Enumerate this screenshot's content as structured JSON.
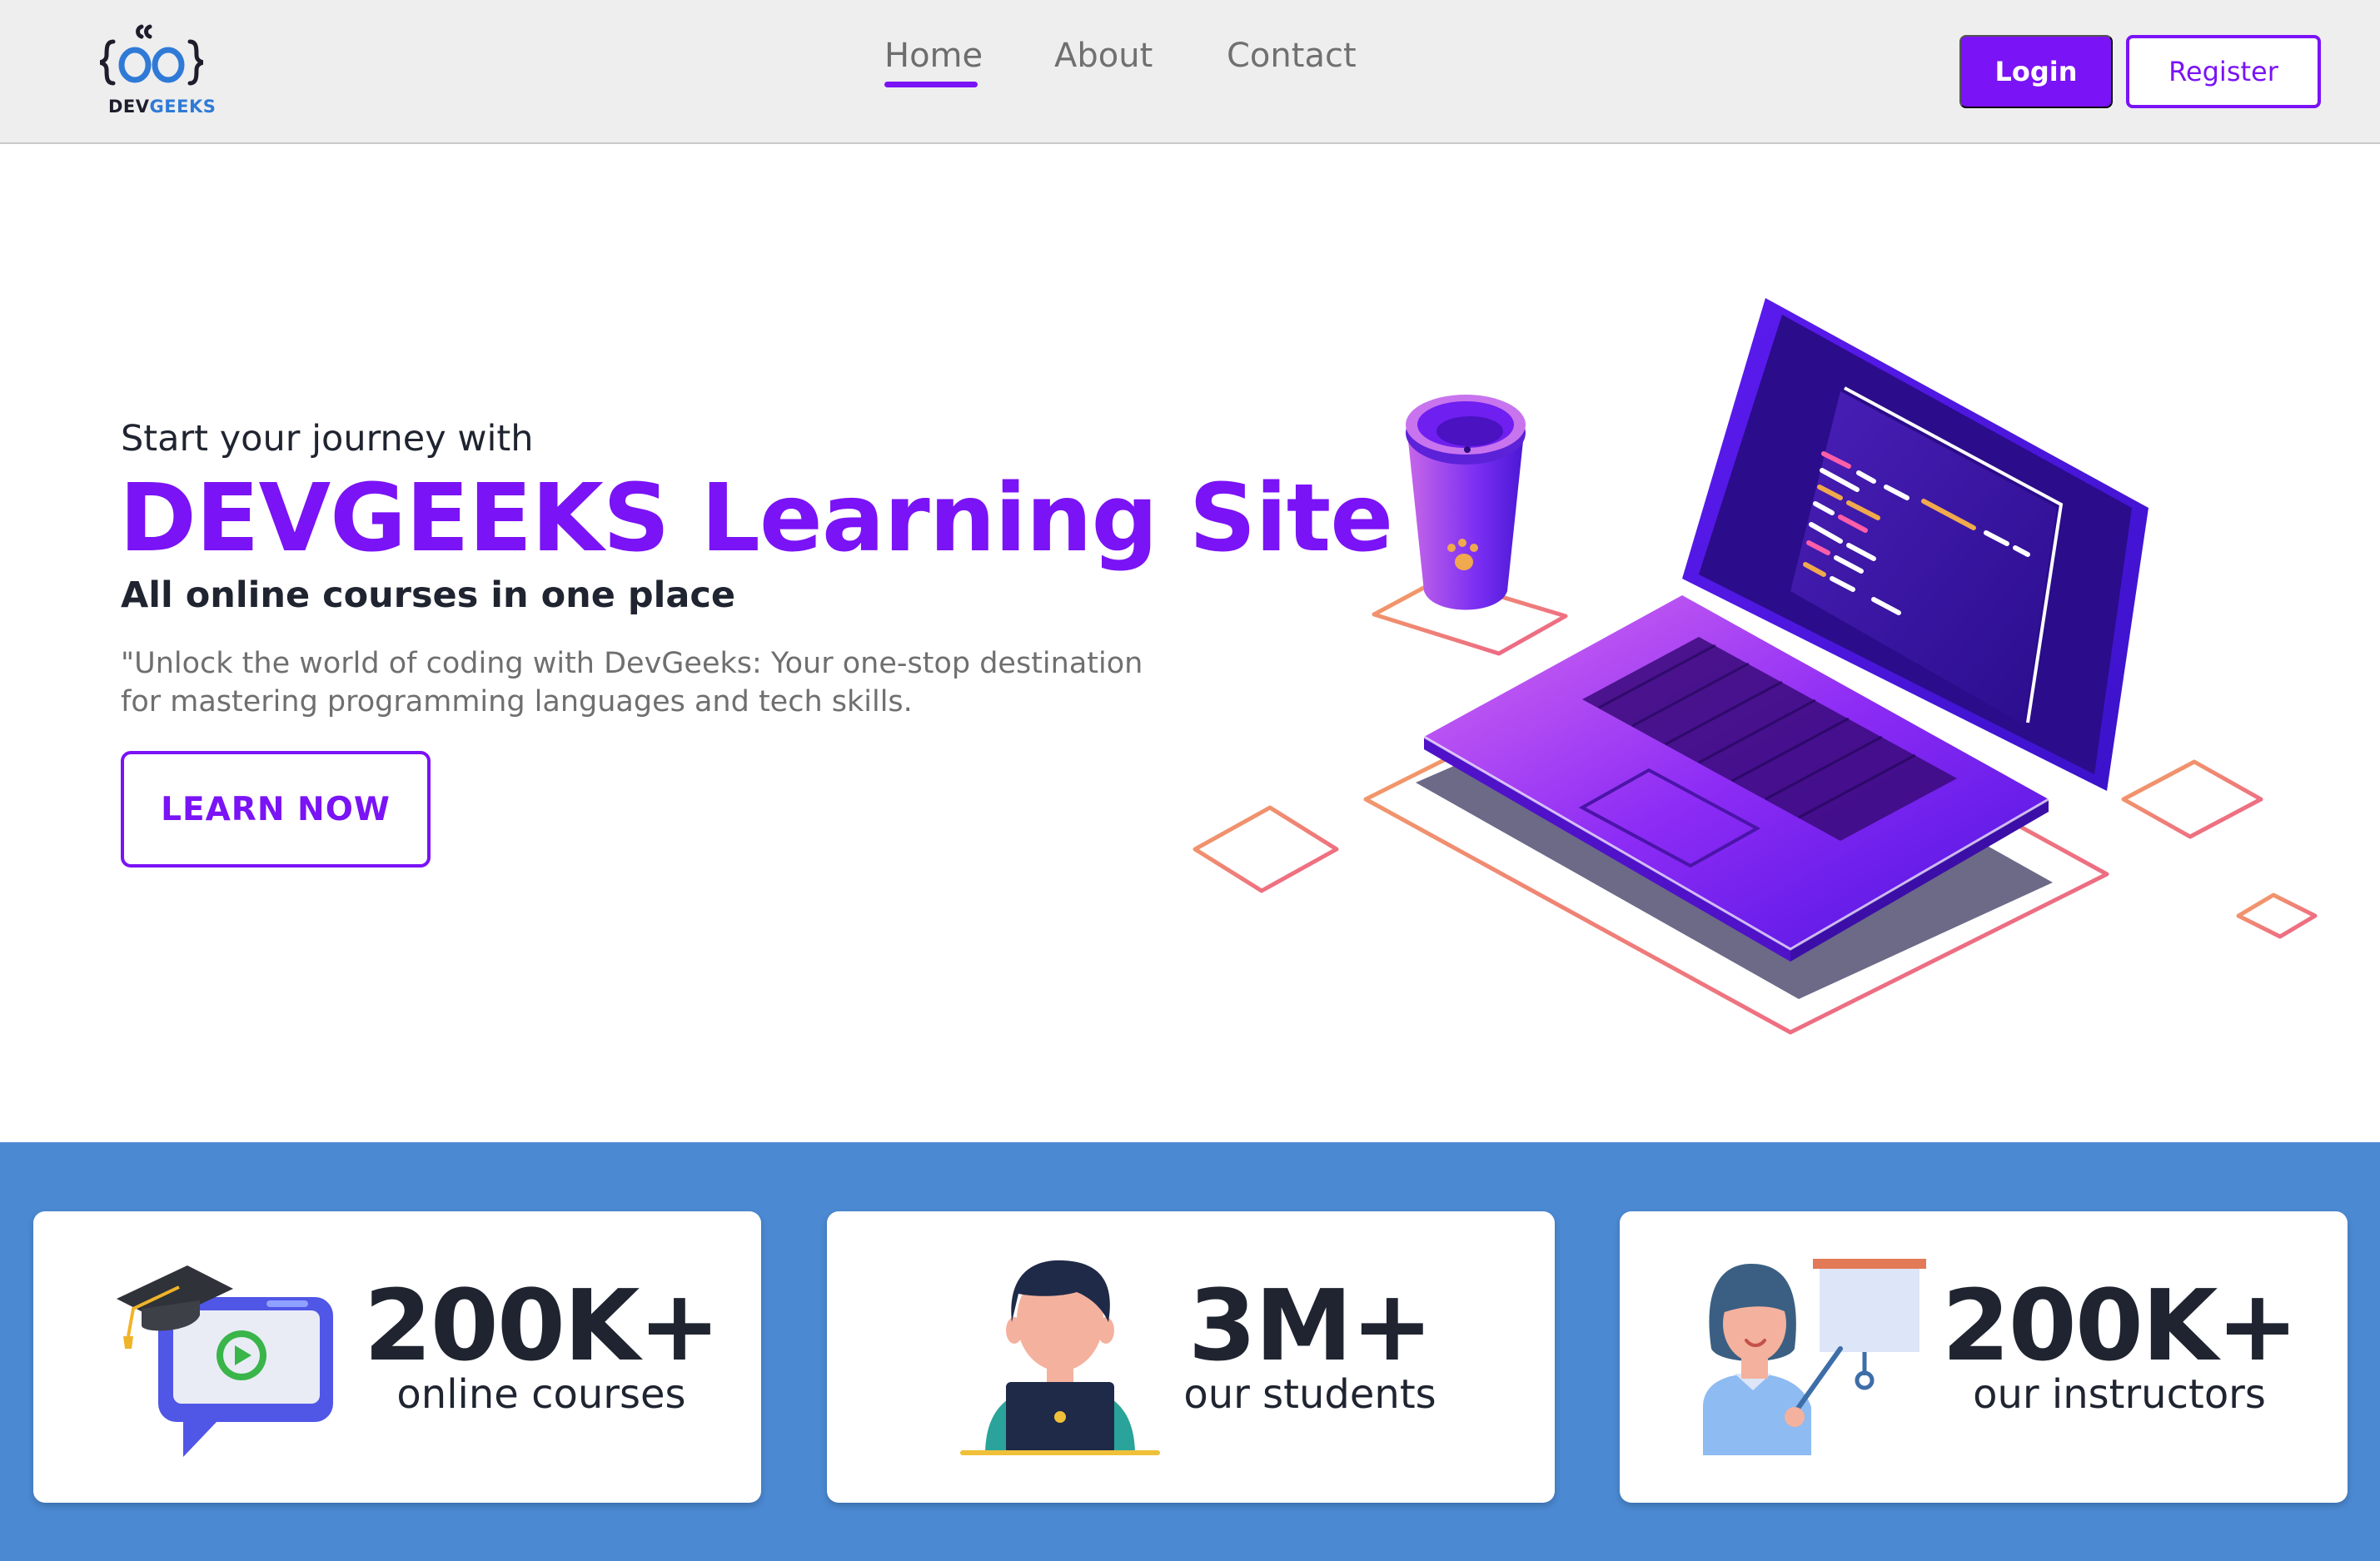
{
  "brand": {
    "name_part1": "DEV",
    "name_part2": "GEEKS",
    "icon": "devgeeks-logo-icon",
    "accent_color": "#7a13f5",
    "secondary_color": "#4b89d2"
  },
  "nav": {
    "links": [
      {
        "label": "Home",
        "active": true
      },
      {
        "label": "About",
        "active": false
      },
      {
        "label": "Contact",
        "active": false
      }
    ],
    "login_label": "Login",
    "register_label": "Register"
  },
  "hero": {
    "kicker": "Start your journey with",
    "title": "DEVGEEKS Learning Site",
    "subtitle": "All online courses in one place",
    "description": "\"Unlock the world of coding with DevGeeks: Your one-stop destination for mastering programming languages and tech skills.",
    "cta_label": "LEARN NOW",
    "illustration": "laptop-coffee-isometric-illustration"
  },
  "stats": [
    {
      "value": "200K+",
      "label": "online courses",
      "icon": "graduation-video-icon"
    },
    {
      "value": "3M+",
      "label": "our students",
      "icon": "student-laptop-icon"
    },
    {
      "value": "200K+",
      "label": "our instructors",
      "icon": "instructor-board-icon"
    }
  ]
}
